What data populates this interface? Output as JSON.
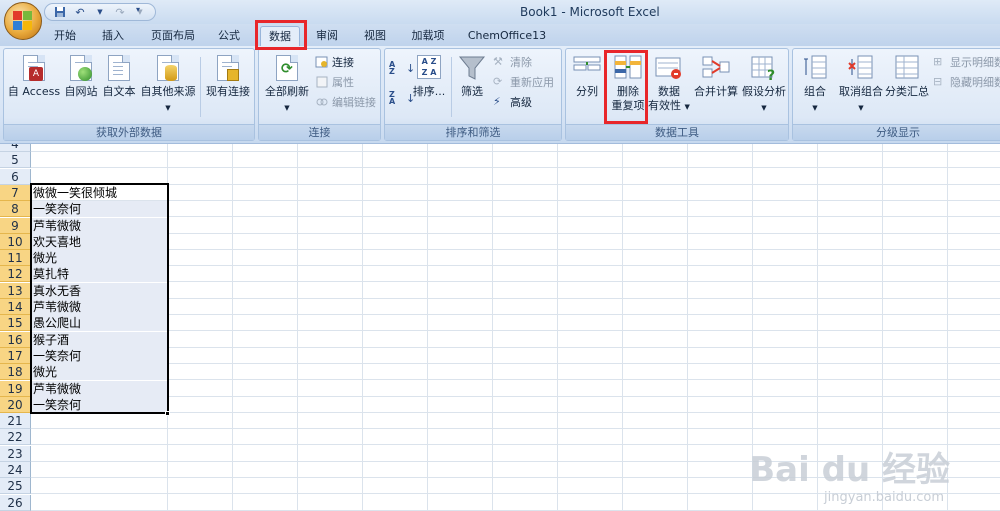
{
  "window": {
    "title": "Book1 - Microsoft Excel"
  },
  "tabs": [
    "开始",
    "插入",
    "页面布局",
    "公式",
    "数据",
    "审阅",
    "视图",
    "加载项",
    "ChemOffice13"
  ],
  "active_tab": "数据",
  "groups": {
    "external": {
      "label": "获取外部数据",
      "access": "自 Access",
      "web": "自网站",
      "text": "自文本",
      "other": "自其他来源",
      "existing": "现有连接"
    },
    "connections": {
      "label": "连接",
      "refresh_all": "全部刷新",
      "connections": "连接",
      "properties": "属性",
      "edit_links": "编辑链接"
    },
    "sort_filter": {
      "label": "排序和筛选",
      "sort": "排序...",
      "filter": "筛选",
      "clear": "清除",
      "reapply": "重新应用",
      "advanced": "高级"
    },
    "data_tools": {
      "label": "数据工具",
      "text_to_columns": "分列",
      "remove_dup_1": "删除",
      "remove_dup_2": "重复项",
      "validation_1": "数据",
      "validation_2": "有效性",
      "consolidate": "合并计算",
      "what_if": "假设分析"
    },
    "outline": {
      "label": "分级显示",
      "group": "组合",
      "ungroup": "取消组合",
      "subtotal": "分类汇总",
      "show_detail": "显示明细数",
      "hide_detail": "隐藏明细数"
    }
  },
  "sheet": {
    "rows": [
      {
        "num": "4",
        "value": ""
      },
      {
        "num": "5",
        "value": ""
      },
      {
        "num": "6",
        "value": ""
      },
      {
        "num": "7",
        "value": "微微一笑很倾城"
      },
      {
        "num": "8",
        "value": "一笑奈何"
      },
      {
        "num": "9",
        "value": "芦苇微微"
      },
      {
        "num": "10",
        "value": "欢天喜地"
      },
      {
        "num": "11",
        "value": "微光"
      },
      {
        "num": "12",
        "value": "莫扎特"
      },
      {
        "num": "13",
        "value": "真水无香"
      },
      {
        "num": "14",
        "value": "芦苇微微"
      },
      {
        "num": "15",
        "value": "愚公爬山"
      },
      {
        "num": "16",
        "value": "猴子酒"
      },
      {
        "num": "17",
        "value": "一笑奈何"
      },
      {
        "num": "18",
        "value": "微光"
      },
      {
        "num": "19",
        "value": "芦苇微微"
      },
      {
        "num": "20",
        "value": "一笑奈何"
      },
      {
        "num": "21",
        "value": ""
      },
      {
        "num": "22",
        "value": ""
      },
      {
        "num": "23",
        "value": ""
      },
      {
        "num": "24",
        "value": ""
      },
      {
        "num": "25",
        "value": ""
      },
      {
        "num": "26",
        "value": ""
      }
    ]
  },
  "watermark": {
    "brand": "Bai du 经验",
    "url": "jingyan.baidu.com"
  },
  "colors": {
    "highlight": "#e8262a",
    "selection_header": "#f8d584"
  }
}
